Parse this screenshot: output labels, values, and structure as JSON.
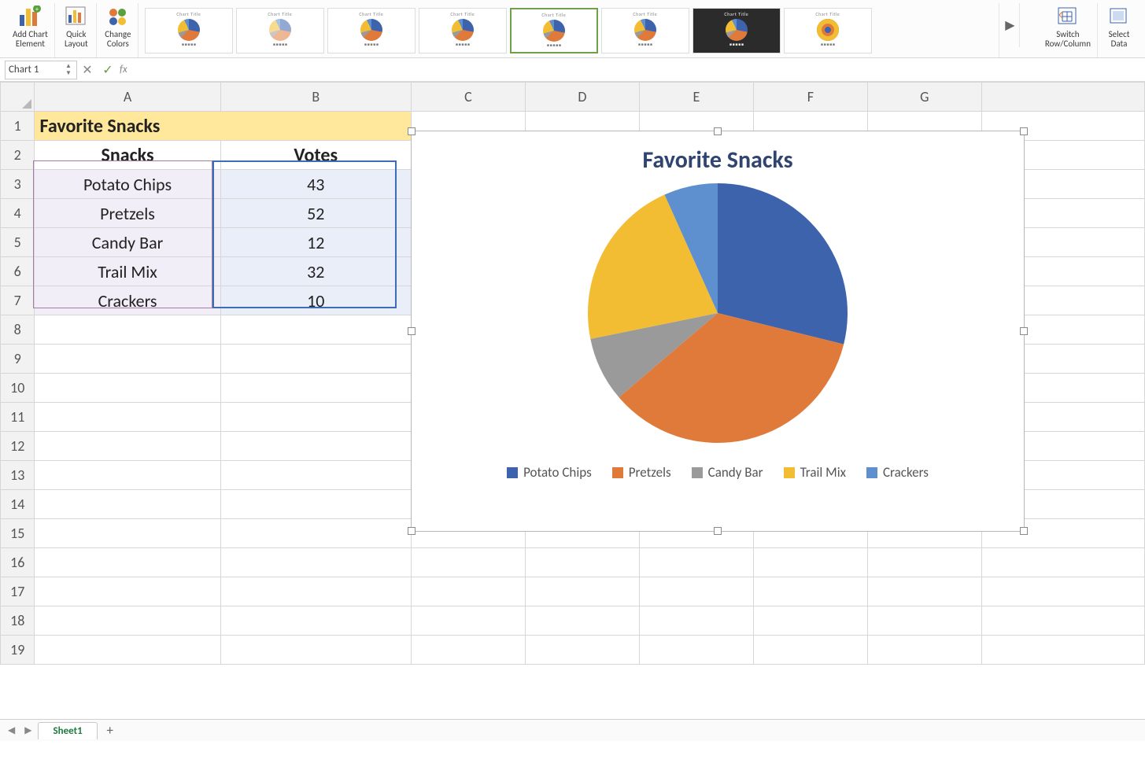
{
  "ribbon": {
    "add_chart_element": "Add Chart\nElement",
    "quick_layout": "Quick\nLayout",
    "change_colors": "Change\nColors",
    "switch_rc": "Switch\nRow/Column",
    "select_data": "Select\nData",
    "gallery_next": "▶"
  },
  "namebox": {
    "value": "Chart 1"
  },
  "columns": [
    "A",
    "B",
    "C",
    "D",
    "E",
    "F",
    "G"
  ],
  "row_count": 19,
  "table": {
    "title": "Favorite Snacks",
    "headers": {
      "a": "Snacks",
      "b": "Votes"
    },
    "rows": [
      {
        "snack": "Potato Chips",
        "votes": 43
      },
      {
        "snack": "Pretzels",
        "votes": 52
      },
      {
        "snack": "Candy Bar",
        "votes": 12
      },
      {
        "snack": "Trail Mix",
        "votes": 32
      },
      {
        "snack": "Crackers",
        "votes": 10
      }
    ]
  },
  "chart_data": {
    "type": "pie",
    "title": "Favorite Snacks",
    "categories": [
      "Potato Chips",
      "Pretzels",
      "Candy Bar",
      "Trail Mix",
      "Crackers"
    ],
    "values": [
      43,
      52,
      12,
      32,
      10
    ],
    "colors": [
      "#3c63ab",
      "#e07a3b",
      "#9a9a9a",
      "#f2bd33",
      "#5e8fce"
    ],
    "legend_position": "bottom"
  },
  "footer": {
    "sheet_tab": "Sheet1",
    "add_tab": "+"
  }
}
